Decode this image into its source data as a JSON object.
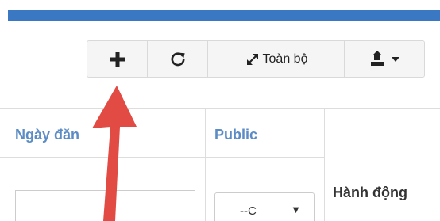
{
  "toolbar": {
    "add_icon": "plus-icon",
    "refresh_icon": "refresh-icon",
    "toggle_icon": "expand-icon",
    "toggle_label": "Toàn bộ",
    "export_icon": "export-icon"
  },
  "table": {
    "columns": {
      "date": "Ngày đăn",
      "public": "Public",
      "action": "Hành động"
    },
    "filters": {
      "date_value": "",
      "public_value": "--C"
    }
  },
  "colors": {
    "top_bar": "#3a78c3",
    "header_text": "#5b8cc5",
    "arrow": "#e24a44"
  }
}
